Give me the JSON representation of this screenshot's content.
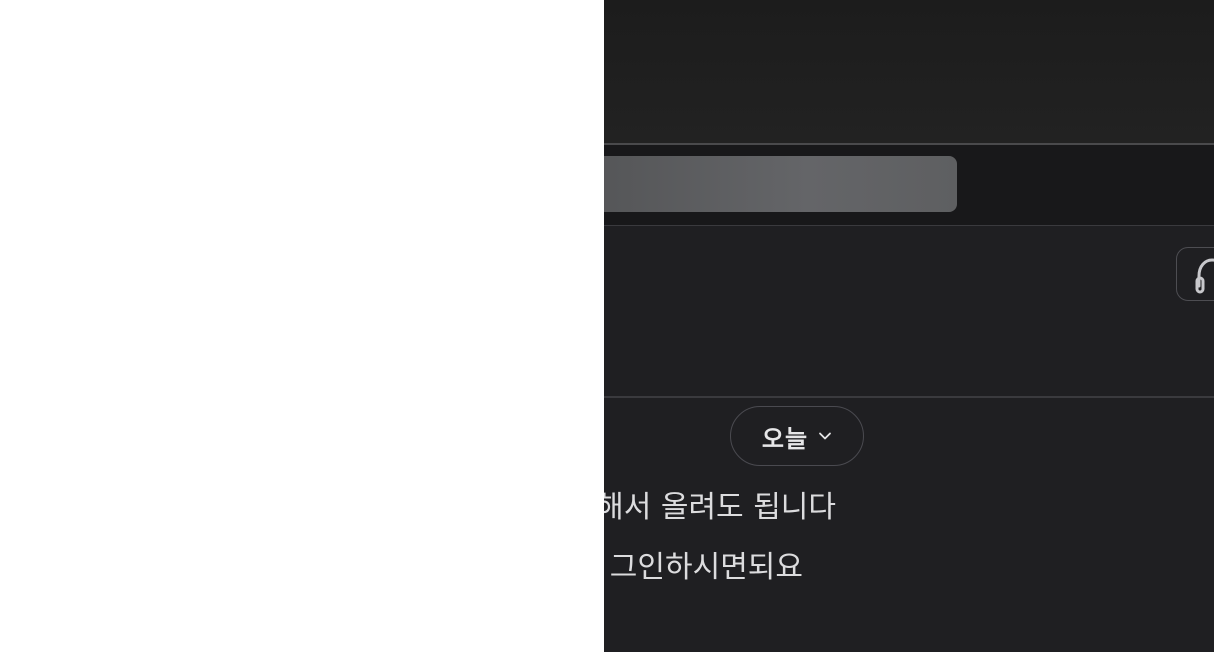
{
  "date_filter": {
    "label": "오늘"
  },
  "messages": [
    {
      "text": "해서 올려도 됩니다"
    },
    {
      "text": "그인하시면되요"
    }
  ],
  "colors": {
    "dark_bg": "#1f1f22",
    "header_bg": "#222222",
    "search_bar": "#646568",
    "text": "#dcdcde",
    "border": "#4a4a50"
  },
  "icons": {
    "side_button": "headset-icon",
    "date_chevron": "chevron-down-icon"
  }
}
